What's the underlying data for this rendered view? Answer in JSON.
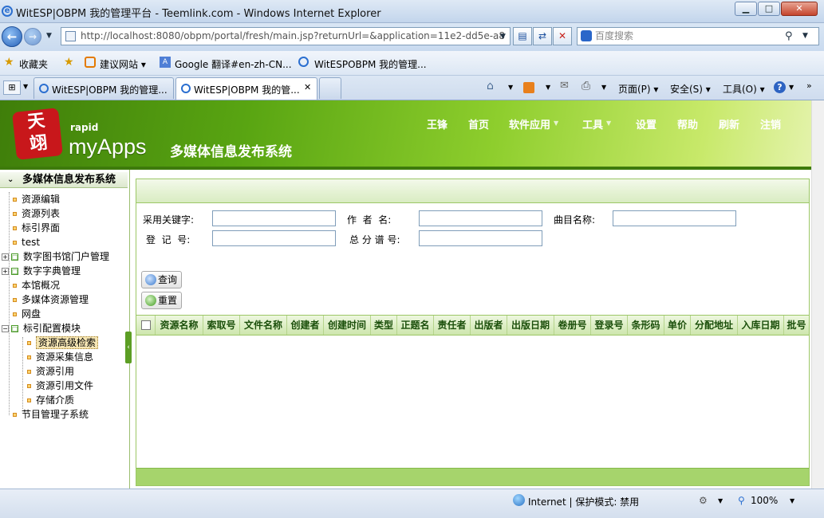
{
  "window": {
    "title": "WitESP|OBPM 我的管理平台 - Teemlink.com - Windows Internet Explorer",
    "minimize": "▁",
    "maximize": "□",
    "close": "✕"
  },
  "address": {
    "url": "http://localhost:8080/obpm/portal/fresh/main.jsp?returnUrl=&application=11e2-dd5e-a8",
    "search_placeholder": "百度搜索"
  },
  "favorites": {
    "label": "收藏夹",
    "items": [
      "建议网站 ▾",
      "Google 翻译#en-zh-CN...",
      "WitESPOBPM 我的管理..."
    ]
  },
  "tabs": [
    "WitESP|OBPM 我的管理...",
    "WitESP|OBPM 我的管..."
  ],
  "commands": {
    "page": "页面(P) ▾",
    "safety": "安全(S) ▾",
    "tools": "工具(O) ▾"
  },
  "app": {
    "logo_text": "天\n翊",
    "rapid": "rapid",
    "brand": "myApps",
    "system_name": "多媒体信息发布系统",
    "nav": [
      "王锋",
      "首页",
      "软件应用",
      "工具",
      "设置",
      "帮助",
      "刷新",
      "注销"
    ]
  },
  "sidebar": {
    "title": "多媒体信息发布系统",
    "items": [
      {
        "label": "资源编辑"
      },
      {
        "label": "资源列表"
      },
      {
        "label": "标引界面"
      },
      {
        "label": "test"
      },
      {
        "label": "数字图书馆门户管理"
      },
      {
        "label": "数字字典管理"
      },
      {
        "label": "本馆概况"
      },
      {
        "label": "多媒体资源管理"
      },
      {
        "label": "网盘"
      },
      {
        "label": "标引配置模块"
      },
      {
        "label": "资源高级检索"
      },
      {
        "label": "资源采集信息"
      },
      {
        "label": "资源引用"
      },
      {
        "label": "资源引用文件"
      },
      {
        "label": "存储介质"
      },
      {
        "label": "节目管理子系统"
      }
    ]
  },
  "form": {
    "keyword_label": "采用关键字:",
    "author_label": "作  者  名:",
    "title_label": "曲目名称:",
    "regno_label": "登  记  号:",
    "totalno_label": "总 分 谱 号:",
    "query_button": "查询",
    "reset_button": "重置"
  },
  "table": {
    "headers": [
      "资源名称",
      "索取号",
      "文件名称",
      "创建者",
      "创建时间",
      "类型",
      "正题名",
      "责任者",
      "出版者",
      "出版日期",
      "卷册号",
      "登录号",
      "条形码",
      "单价",
      "分配地址",
      "入库日期",
      "批号"
    ]
  },
  "status": {
    "zone": "Internet | 保护模式: 禁用",
    "zoom": "100%"
  }
}
